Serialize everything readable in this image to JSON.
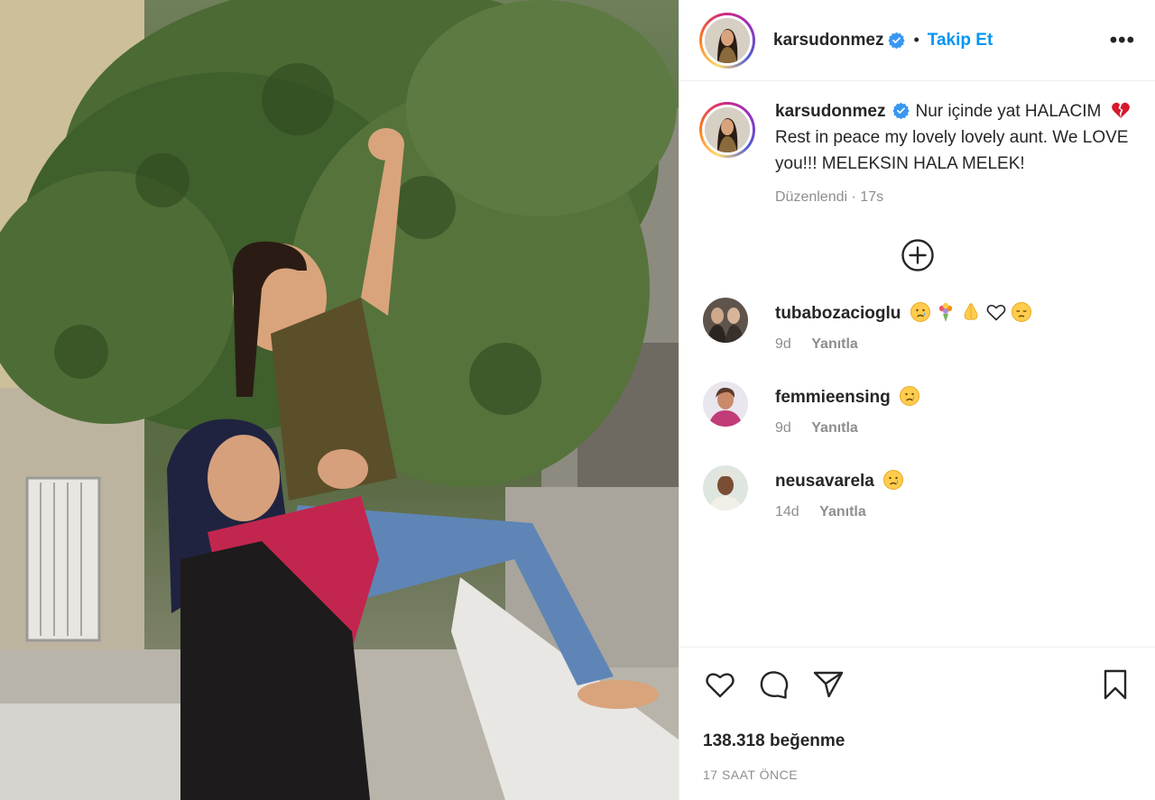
{
  "header": {
    "username": "karsudonmez",
    "separator": "•",
    "follow_label": "Takip Et",
    "more_label": "•••"
  },
  "caption": {
    "username": "karsudonmez",
    "text_before": "Nur içinde yat HALACIM",
    "emoji": "broken-heart",
    "text_after": "Rest in peace my lovely lovely aunt. We LOVE you!!! MELEKSIN HALA MELEK!",
    "edited": "Düzenlendi",
    "edited_sep": "·",
    "age": "17s"
  },
  "comments": [
    {
      "username": "tubabozacioglu",
      "emojis": [
        "crying-face",
        "bouquet",
        "folded-hands",
        "white-heart",
        "pensive-face"
      ],
      "age": "9d",
      "reply_label": "Yanıtla"
    },
    {
      "username": "femmieensing",
      "emojis": [
        "crying-face"
      ],
      "age": "9d",
      "reply_label": "Yanıtla"
    },
    {
      "username": "neusavarela",
      "emojis": [
        "crying-face"
      ],
      "age": "14d",
      "reply_label": "Yanıtla"
    }
  ],
  "actions": {
    "likes": "138.318 beğenme",
    "timestamp": "17 SAAT ÖNCE"
  },
  "colors": {
    "accent": "#0095f6",
    "muted": "#8e8e8e",
    "text": "#262626",
    "verified": "#3897f0"
  }
}
